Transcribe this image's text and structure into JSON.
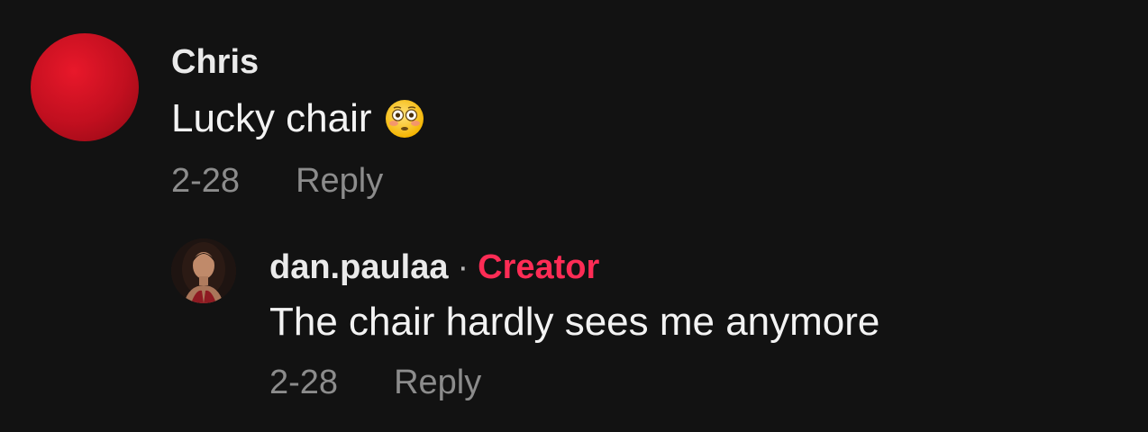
{
  "comments": [
    {
      "username": "Chris",
      "text": "Lucky chair",
      "emoji_icon": "flushed-face-emoji",
      "date": "2-28",
      "reply_label": "Reply",
      "avatar_color": "#d4111f",
      "replies": [
        {
          "username": "dan.paulaa",
          "separator": "·",
          "badge": "Creator",
          "badge_color": "#fe2c55",
          "text": "The chair hardly sees me anymore",
          "date": "2-28",
          "reply_label": "Reply"
        }
      ]
    }
  ]
}
